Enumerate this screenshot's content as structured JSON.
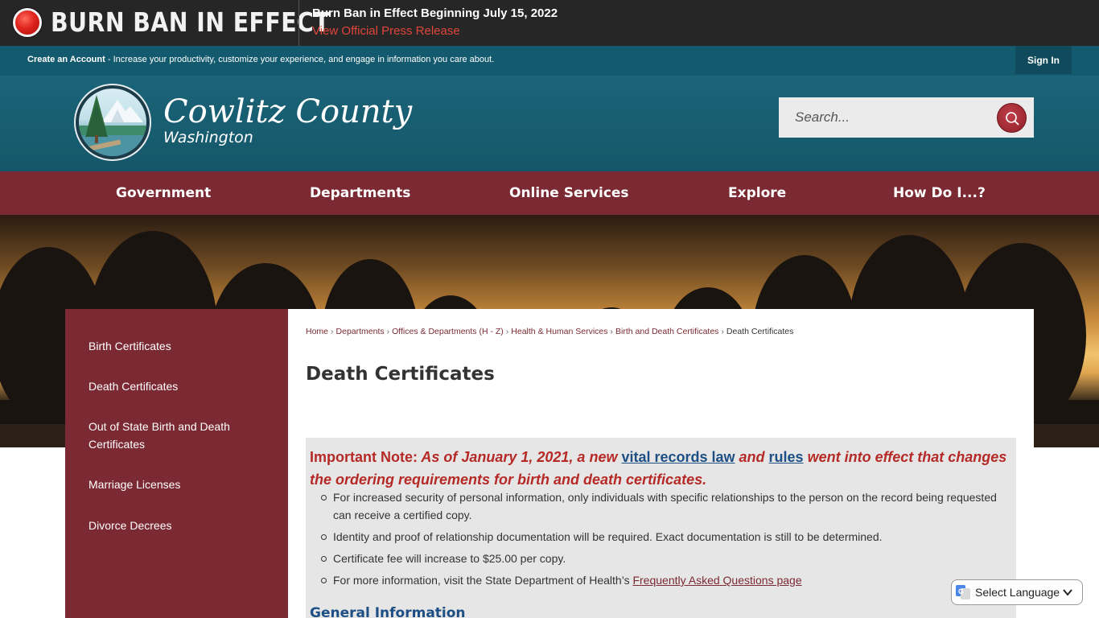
{
  "alert": {
    "title": "BURN BAN IN EFFECT",
    "headline": "Burn Ban in Effect Beginning July 15, 2022",
    "link": "View Official Press Release"
  },
  "account": {
    "create_label": "Create an Account",
    "create_desc": " - Increase your productivity, customize your experience, and engage in information you care about.",
    "signin_label": "Sign In"
  },
  "header": {
    "county_name": "Cowlitz County",
    "state_name": "Washington",
    "search_placeholder": "Search..."
  },
  "nav": {
    "items": [
      "Government",
      "Departments",
      "Online Services",
      "Explore",
      "How Do I...?"
    ]
  },
  "sidebar": {
    "items": [
      "Birth Certificates",
      "Death Certificates",
      "Out of State Birth and Death Certificates",
      "Marriage Licenses",
      "Divorce Decrees"
    ]
  },
  "breadcrumb": {
    "items": [
      "Home",
      "Departments",
      "Offices & Departments (H - Z)",
      "Health & Human Services",
      "Birth and Death Certificates"
    ],
    "current": "Death Certificates",
    "separator": "›"
  },
  "page": {
    "title": "Death Certificates"
  },
  "note": {
    "label": "Important Note:",
    "text_1": " As of January 1, 2021, a new ",
    "link_1": "vital records law",
    "text_2": " and ",
    "link_2": "rules",
    "text_3": " went into effect that changes the ordering requirements for birth and death certificates.",
    "bullets": [
      "For increased security of personal information, only individuals with specific relationships to the person on the record being requested can receive a certified copy.",
      "Identity and proof of relationship documentation will be required. Exact documentation is still to be determined.",
      "Certificate fee will increase to $25.00 per copy."
    ],
    "bullet_4_text": "For more information, visit the State Department of Health’s ",
    "bullet_4_link": "Frequently Asked Questions page"
  },
  "section": {
    "general_info": "General Information"
  },
  "language": {
    "label": "Select Language"
  },
  "colors": {
    "alert_bg": "#262626",
    "teal": "#135a6e",
    "maroon": "#7b2932",
    "note_red": "#b52a26",
    "link_blue": "#1d4f85"
  }
}
